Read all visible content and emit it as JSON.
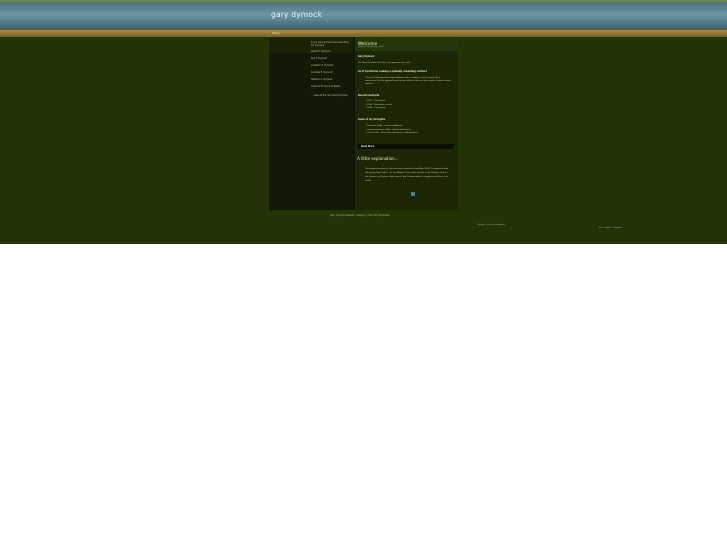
{
  "site": {
    "title": "gary dymock"
  },
  "nav": {
    "home_label": "Home"
  },
  "sidebar": {
    "intro": "If you have arrived here searching for 'Dymock'",
    "links": [
      "Albert E. Dymock",
      "Kay F. Dymock",
      "Jonathan H. Dymock",
      "Amanda E. Dymock",
      "Heather A. Dymock",
      "Florence M. Dymock Beale"
    ],
    "view_all": "... view all the recorded Dymocks"
  },
  "main": {
    "title": "Welcome",
    "subtitle": "Posted 2nd January, 2012",
    "intro_heading": "Gary Dymock",
    "intro_text": "I'm Gary Dymock and this is my place on the web.",
    "contractor_heading": "An IT Contractor seeking a mutually rewarding contract",
    "contractor_quote": "\"I'm an IT Manager/Developer/Analyst who is always in at his work. As a contractor I hit the ground running and deliver value on time and in a professional manner.\"",
    "contracts_heading": "Recent Contracts",
    "contracts": [
      "2011 - Consultant",
      "2009 - Education sector",
      "2008 - Consultant"
    ],
    "strengths_heading": "Some of my strengths",
    "strengths": [
      "Technical skills - various platforms",
      "Communications skills - clients and others",
      "Client skills - delivering solutions to stakeholders"
    ],
    "read_more": "Read More",
    "explain_title": "A little explanation...",
    "explain_text": "The original version of this site was created in FrontPage 2003. I wondered what the young Gary didn't - so FrontPage! If you want to look at old history, click on the famous 'sp' button from search. But I downloaded a template and this is the result."
  },
  "footer": {
    "text": "Gary Dymock Website - Design by Free CSS Templates"
  },
  "extra": {
    "note_a": "Design: free css templates",
    "note_b": "Free website template"
  }
}
